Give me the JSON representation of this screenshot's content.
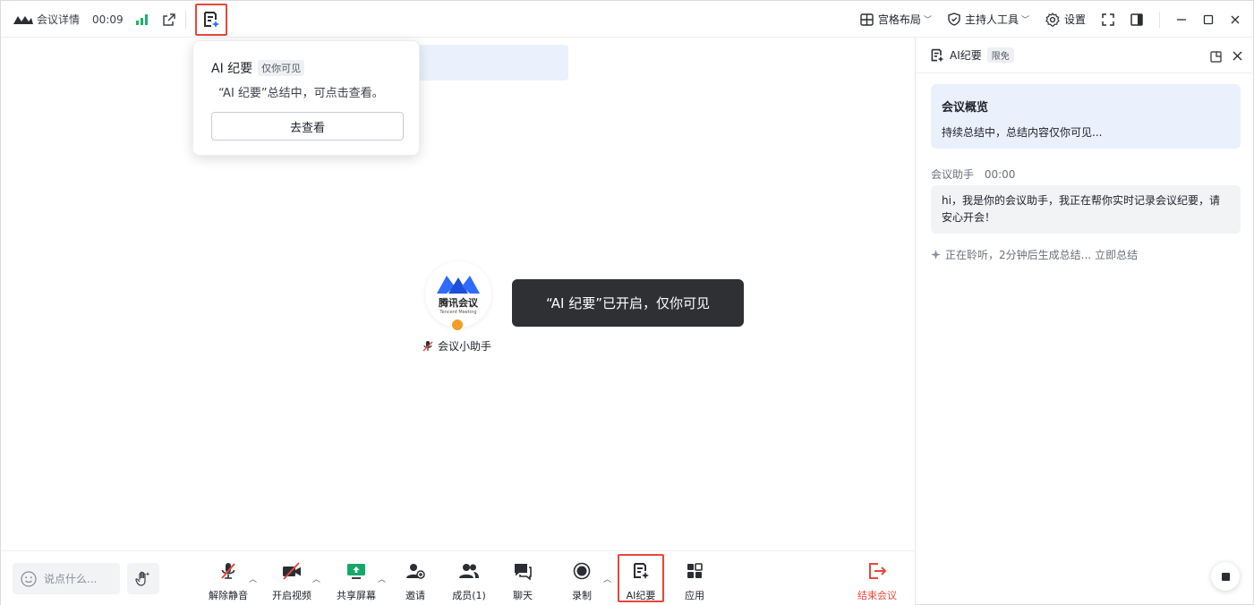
{
  "topbar": {
    "title": "会议详情",
    "time": "00:09",
    "right_items": {
      "layout": "宫格布局",
      "host_tools": "主持人工具",
      "settings": "设置"
    }
  },
  "popover": {
    "title": "AI 纪要",
    "badge": "仅你可见",
    "text": "“AI 纪要”总结中，可点击查看。",
    "button": "去查看"
  },
  "stage": {
    "participant_brand": "腾讯会议",
    "participant_brand_en": "Tencent Meeting",
    "participant_name": "会议小助手",
    "toast": "“AI 纪要”已开启，仅你可见"
  },
  "panel": {
    "title": "AI纪要",
    "badge": "限免",
    "summary_title": "会议概览",
    "summary_text": "持续总结中，总结内容仅你可见...",
    "assistant_name": "会议助手",
    "assistant_time": "00:00",
    "assistant_message": "hi，我是你的会议助手，我正在帮你实时记录会议纪要，请安心开会！",
    "listening_text": "正在聆听，2分钟后生成总结...",
    "summarize_now": "立即总结"
  },
  "bottombar": {
    "chat_placeholder": "说点什么...",
    "tools": {
      "unmute": "解除静音",
      "video": "开启视频",
      "share": "共享屏幕",
      "invite": "邀请",
      "members": "成员(1)",
      "chat": "聊天",
      "record": "录制",
      "ai": "AI纪要",
      "apps": "应用",
      "end": "结束会议"
    }
  },
  "colors": {
    "accent_red": "#e5483b",
    "signal_green": "#1cb46a",
    "brand_blue": "#2f6bff",
    "card_blue": "#eaf1fd"
  }
}
